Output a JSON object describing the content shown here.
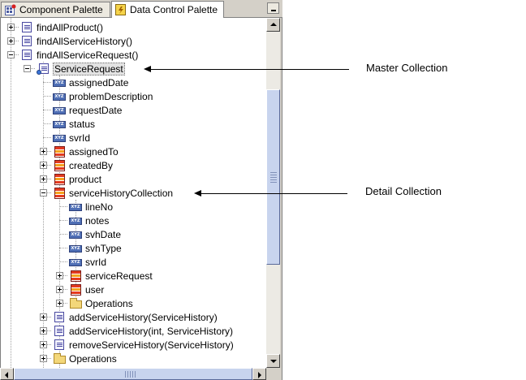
{
  "tabs": [
    {
      "label": "Component Palette",
      "icon": "component-palette-icon",
      "active": false
    },
    {
      "label": "Data Control Palette",
      "icon": "data-control-palette-icon",
      "active": true
    }
  ],
  "tree": [
    {
      "label": "findAllProduct()",
      "level": 1,
      "expander": "plus",
      "icon": "method"
    },
    {
      "label": "findAllServiceHistory()",
      "level": 1,
      "expander": "plus",
      "icon": "method"
    },
    {
      "label": "findAllServiceRequest()",
      "level": 1,
      "expander": "minus",
      "icon": "method"
    },
    {
      "label": "ServiceRequest",
      "level": 2,
      "expander": "minus",
      "icon": "master",
      "selected": true
    },
    {
      "label": "assignedDate",
      "level": 3,
      "expander": "none",
      "icon": "attr"
    },
    {
      "label": "problemDescription",
      "level": 3,
      "expander": "none",
      "icon": "attr"
    },
    {
      "label": "requestDate",
      "level": 3,
      "expander": "none",
      "icon": "attr"
    },
    {
      "label": "status",
      "level": 3,
      "expander": "none",
      "icon": "attr"
    },
    {
      "label": "svrId",
      "level": 3,
      "expander": "none",
      "icon": "attr"
    },
    {
      "label": "assignedTo",
      "level": 3,
      "expander": "plus",
      "icon": "coll"
    },
    {
      "label": "createdBy",
      "level": 3,
      "expander": "plus",
      "icon": "coll"
    },
    {
      "label": "product",
      "level": 3,
      "expander": "plus",
      "icon": "coll"
    },
    {
      "label": "serviceHistoryCollection",
      "level": 3,
      "expander": "minus",
      "icon": "coll"
    },
    {
      "label": "lineNo",
      "level": 4,
      "expander": "none",
      "icon": "attr"
    },
    {
      "label": "notes",
      "level": 4,
      "expander": "none",
      "icon": "attr"
    },
    {
      "label": "svhDate",
      "level": 4,
      "expander": "none",
      "icon": "attr"
    },
    {
      "label": "svhType",
      "level": 4,
      "expander": "none",
      "icon": "attr"
    },
    {
      "label": "svrId",
      "level": 4,
      "expander": "none",
      "icon": "attr"
    },
    {
      "label": "serviceRequest",
      "level": 4,
      "expander": "plus",
      "icon": "coll"
    },
    {
      "label": "user",
      "level": 4,
      "expander": "plus",
      "icon": "coll"
    },
    {
      "label": "Operations",
      "level": 4,
      "expander": "plus",
      "icon": "folder"
    },
    {
      "label": "addServiceHistory(ServiceHistory)",
      "level": 3,
      "expander": "plus",
      "icon": "method"
    },
    {
      "label": "addServiceHistory(int, ServiceHistory)",
      "level": 3,
      "expander": "plus",
      "icon": "method"
    },
    {
      "label": "removeServiceHistory(ServiceHistory)",
      "level": 3,
      "expander": "plus",
      "icon": "method"
    },
    {
      "label": "Operations",
      "level": 3,
      "expander": "plus",
      "icon": "folder"
    }
  ],
  "attr_icon_text": "XYZ",
  "annotations": {
    "master": "Master Collection",
    "detail": "Detail Collection"
  }
}
